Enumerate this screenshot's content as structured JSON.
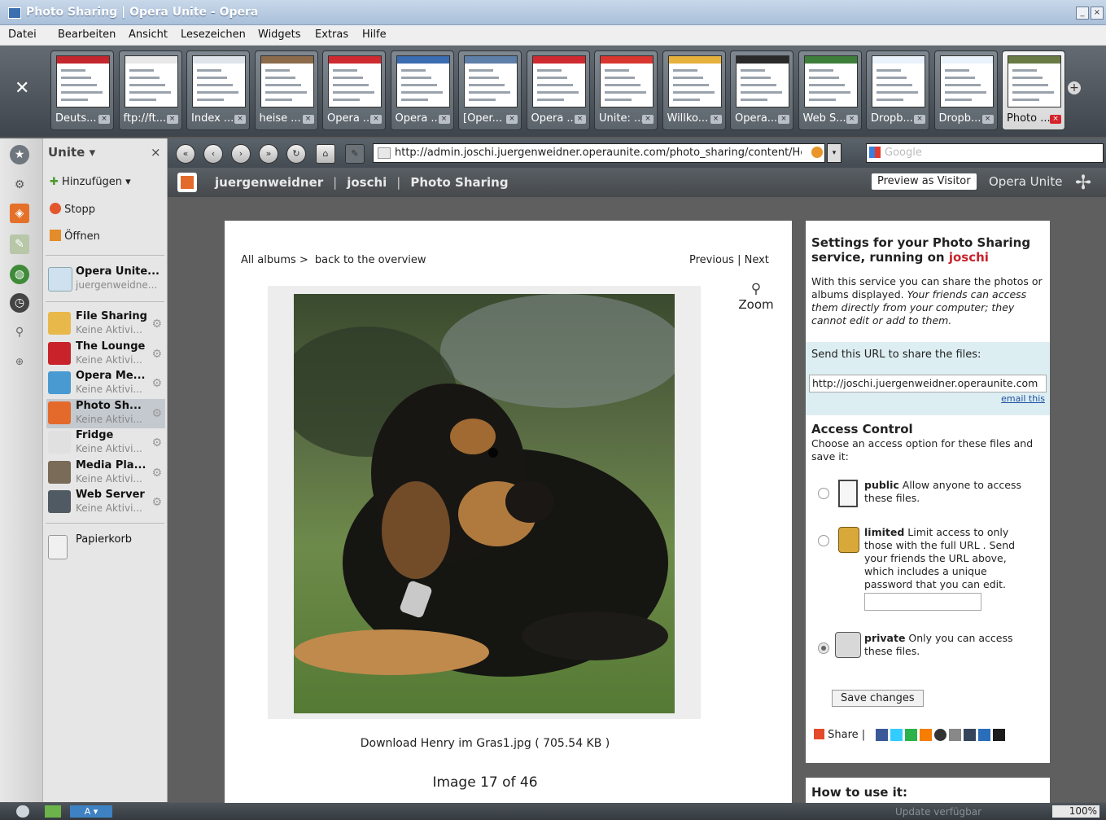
{
  "window": {
    "title": "Photo Sharing | Opera Unite - Opera"
  },
  "menu": [
    "Datei",
    "Bearbeiten",
    "Ansicht",
    "Lesezeichen",
    "Widgets",
    "Extras",
    "Hilfe"
  ],
  "tabs": [
    {
      "label": "Deuts...",
      "color": "#c4262e"
    },
    {
      "label": "ftp://ft...",
      "color": "#e8e8e8"
    },
    {
      "label": "Index ...",
      "color": "#dfe4ea"
    },
    {
      "label": "heise ...",
      "color": "#8c6b4a"
    },
    {
      "label": "Opera ...",
      "color": "#cf2a2f"
    },
    {
      "label": "Opera ...",
      "color": "#3a6cb0"
    },
    {
      "label": "[Oper...",
      "color": "#5d7fa8"
    },
    {
      "label": "Opera ...",
      "color": "#cf2a2f"
    },
    {
      "label": "Unite: ...",
      "color": "#d9362f"
    },
    {
      "label": "Willko...",
      "color": "#e6b13c"
    },
    {
      "label": "Opera...",
      "color": "#2a2a2a"
    },
    {
      "label": "Web S...",
      "color": "#3d7f3a"
    },
    {
      "label": "Dropb...",
      "color": "#eaf2fb"
    },
    {
      "label": "Dropb...",
      "color": "#eaf2fb"
    },
    {
      "label": "Photo ...",
      "color": "#6a7a44"
    }
  ],
  "sidebar": {
    "header": "Unite",
    "add": "Hinzufügen",
    "stop": "Stopp",
    "open": "Öffnen",
    "home": {
      "name": "Opera Unite...",
      "user": "juergenweidne..."
    },
    "services": [
      {
        "name": "File Sharing",
        "status": "Keine Aktivi...",
        "color": "#e8b94a"
      },
      {
        "name": "The Lounge",
        "status": "Keine Aktivi...",
        "color": "#c8232b"
      },
      {
        "name": "Opera Me...",
        "status": "Keine Aktivi...",
        "color": "#4a9ad2"
      },
      {
        "name": "Photo Sh...",
        "status": "Keine Aktivi...",
        "color": "#e46a2c"
      },
      {
        "name": "Fridge",
        "status": "Keine Aktivi...",
        "color": "#e0e0e0"
      },
      {
        "name": "Media Pla...",
        "status": "Keine Aktivi...",
        "color": "#7a6a58"
      },
      {
        "name": "Web Server",
        "status": "Keine Aktivi...",
        "color": "#505a62"
      }
    ],
    "trash": "Papierkorb"
  },
  "address": {
    "url": "http://admin.joschi.juergenweidner.operaunite.com/photo_sharing/content/Henr",
    "search_placeholder": "Google"
  },
  "unite_header": {
    "user": "juergenweidner",
    "device": "joschi",
    "service": "Photo Sharing",
    "preview": "Preview as Visitor",
    "brand": "Opera Unite"
  },
  "photo": {
    "crumb_all": "All albums >",
    "crumb_back": "back to the overview",
    "prev": "Previous",
    "next": "Next",
    "zoom": "Zoom",
    "download": "Download Henry im Gras1.jpg ( 705.54 KB )",
    "counter": "Image 17 of 46"
  },
  "settings": {
    "title_prefix": "Settings for your Photo Sharing service, running on",
    "device": "joschi",
    "desc_plain": "With this service you can share the photos or albums displayed.",
    "desc_italic": "Your friends can access them directly from your computer; they cannot edit or add to them.",
    "share_label": "Send this URL to share the files:",
    "share_url": "http://joschi.juergenweidner.operaunite.com",
    "email_link": "email this",
    "access_title": "Access Control",
    "access_desc": "Choose an access option for these files and save it:",
    "public_bold": "public",
    "public_text": "Allow anyone to access these files.",
    "limited_bold": "limited",
    "limited_text": "Limit access to only those with the full URL . Send your friends the URL above, which includes a unique password that you can edit.",
    "private_bold": "private",
    "private_text": "Only you can access these files.",
    "save": "Save changes",
    "share": "Share",
    "howto": "How to use it:"
  },
  "status": {
    "update": "Update verfügbar",
    "zoom": "100%"
  }
}
